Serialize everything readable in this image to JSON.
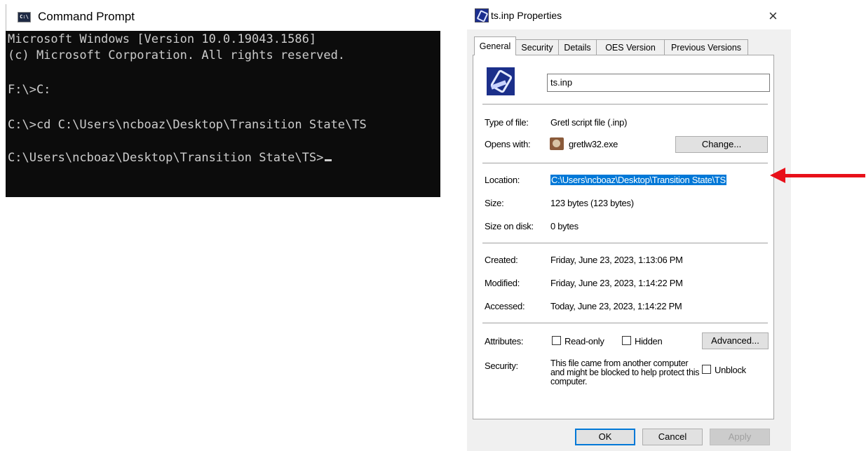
{
  "cmd": {
    "title": "Command Prompt",
    "icon": "C:\\",
    "lines": [
      "Microsoft Windows [Version 10.0.19043.1586]",
      "(c) Microsoft Corporation. All rights reserved.",
      "F:\\>C:",
      "C:\\>cd C:\\Users\\ncboaz\\Desktop\\Transition State\\TS",
      "C:\\Users\\ncboaz\\Desktop\\Transition State\\TS>"
    ]
  },
  "dialog": {
    "title": "ts.inp Properties",
    "close": "×",
    "tabs": [
      "General",
      "Security",
      "Details",
      "OES Version",
      "Previous Versions"
    ],
    "active_tab": "General",
    "file_name": "ts.inp",
    "type_label": "Type of file:",
    "type_value": "Gretl script file (.inp)",
    "opens_label": "Opens with:",
    "opens_value": "gretlw32.exe",
    "change_button": "Change...",
    "location_label": "Location:",
    "location_value": "C:\\Users\\ncboaz\\Desktop\\Transition State\\TS",
    "size_label": "Size:",
    "size_value": "123 bytes (123 bytes)",
    "size_disk_label": "Size on disk:",
    "size_disk_value": "0 bytes",
    "created_label": "Created:",
    "created_value": "Friday, June 23, 2023, 1:13:06 PM",
    "modified_label": "Modified:",
    "modified_value": "Friday, June 23, 2023, 1:14:22 PM",
    "accessed_label": "Accessed:",
    "accessed_value": "Today, June 23, 2023, 1:14:22 PM",
    "attributes_label": "Attributes:",
    "readonly_label": "Read-only",
    "hidden_label": "Hidden",
    "advanced_button": "Advanced...",
    "security_label": "Security:",
    "security_text": "This file came from another computer and might be blocked to help protect this computer.",
    "unblock_label": "Unblock",
    "ok_button": "OK",
    "cancel_button": "Cancel",
    "apply_button": "Apply"
  },
  "colors": {
    "console_bg": "#0c0c0c",
    "console_text": "#cccccc",
    "selection": "#0078d7",
    "arrow": "#e8101a"
  },
  "icons": {
    "cmd": "cmd-icon",
    "dialog": "gretl-file-icon",
    "app": "gretl-app-icon",
    "arrow": "red-arrow-icon"
  }
}
